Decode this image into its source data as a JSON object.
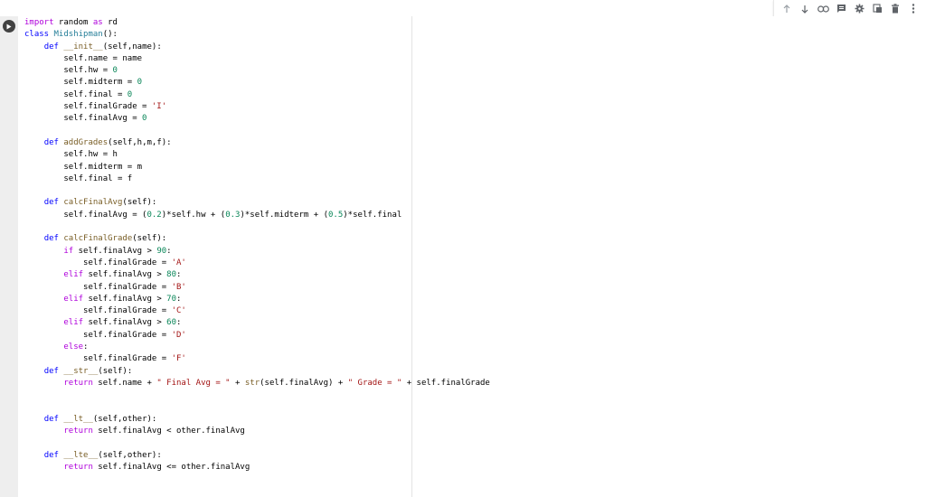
{
  "toolbar": {
    "icons": [
      "arrow-up-icon",
      "arrow-down-icon",
      "link-icon",
      "comment-icon",
      "gear-icon",
      "mirror-cell-icon",
      "trash-icon",
      "more-vert-icon"
    ]
  },
  "colors": {
    "keyword": "#af00db",
    "def": "#0000ff",
    "function": "#795e26",
    "class": "#267f99",
    "number": "#098658",
    "string": "#a31515",
    "gutter": "#eeeeee"
  },
  "code": {
    "lines": [
      [
        {
          "t": "import",
          "c": "kw"
        },
        {
          "t": " random "
        },
        {
          "t": "as",
          "c": "kw"
        },
        {
          "t": " rd"
        }
      ],
      [
        {
          "t": "class",
          "c": "kd"
        },
        {
          "t": " "
        },
        {
          "t": "Midshipman",
          "c": "cls"
        },
        {
          "t": "():"
        }
      ],
      [
        {
          "t": "    "
        },
        {
          "t": "def",
          "c": "kd"
        },
        {
          "t": " "
        },
        {
          "t": "__init__",
          "c": "fn"
        },
        {
          "t": "(self,name):"
        }
      ],
      [
        {
          "t": "        self.name = name"
        }
      ],
      [
        {
          "t": "        self.hw = "
        },
        {
          "t": "0",
          "c": "num"
        }
      ],
      [
        {
          "t": "        self.midterm = "
        },
        {
          "t": "0",
          "c": "num"
        }
      ],
      [
        {
          "t": "        self.final = "
        },
        {
          "t": "0",
          "c": "num"
        }
      ],
      [
        {
          "t": "        self.finalGrade = "
        },
        {
          "t": "'I'",
          "c": "str"
        }
      ],
      [
        {
          "t": "        self.finalAvg = "
        },
        {
          "t": "0",
          "c": "num"
        }
      ],
      [
        {
          "t": ""
        }
      ],
      [
        {
          "t": "    "
        },
        {
          "t": "def",
          "c": "kd"
        },
        {
          "t": " "
        },
        {
          "t": "addGrades",
          "c": "fn"
        },
        {
          "t": "(self,h,m,f):"
        }
      ],
      [
        {
          "t": "        self.hw = h"
        }
      ],
      [
        {
          "t": "        self.midterm = m"
        }
      ],
      [
        {
          "t": "        self.final = f"
        }
      ],
      [
        {
          "t": ""
        }
      ],
      [
        {
          "t": "    "
        },
        {
          "t": "def",
          "c": "kd"
        },
        {
          "t": " "
        },
        {
          "t": "calcFinalAvg",
          "c": "fn"
        },
        {
          "t": "(self):"
        }
      ],
      [
        {
          "t": "        self.finalAvg = ("
        },
        {
          "t": "0.2",
          "c": "num"
        },
        {
          "t": ")*self.hw + ("
        },
        {
          "t": "0.3",
          "c": "num"
        },
        {
          "t": ")*self.midterm + ("
        },
        {
          "t": "0.5",
          "c": "num"
        },
        {
          "t": ")*self.final"
        }
      ],
      [
        {
          "t": ""
        }
      ],
      [
        {
          "t": "    "
        },
        {
          "t": "def",
          "c": "kd"
        },
        {
          "t": " "
        },
        {
          "t": "calcFinalGrade",
          "c": "fn"
        },
        {
          "t": "(self):"
        }
      ],
      [
        {
          "t": "        "
        },
        {
          "t": "if",
          "c": "kw"
        },
        {
          "t": " self.finalAvg > "
        },
        {
          "t": "90",
          "c": "num"
        },
        {
          "t": ":"
        }
      ],
      [
        {
          "t": "            self.finalGrade = "
        },
        {
          "t": "'A'",
          "c": "str"
        }
      ],
      [
        {
          "t": "        "
        },
        {
          "t": "elif",
          "c": "kw"
        },
        {
          "t": " self.finalAvg > "
        },
        {
          "t": "80",
          "c": "num"
        },
        {
          "t": ":"
        }
      ],
      [
        {
          "t": "            self.finalGrade = "
        },
        {
          "t": "'B'",
          "c": "str"
        }
      ],
      [
        {
          "t": "        "
        },
        {
          "t": "elif",
          "c": "kw"
        },
        {
          "t": " self.finalAvg > "
        },
        {
          "t": "70",
          "c": "num"
        },
        {
          "t": ":"
        }
      ],
      [
        {
          "t": "            self.finalGrade = "
        },
        {
          "t": "'C'",
          "c": "str"
        }
      ],
      [
        {
          "t": "        "
        },
        {
          "t": "elif",
          "c": "kw"
        },
        {
          "t": " self.finalAvg > "
        },
        {
          "t": "60",
          "c": "num"
        },
        {
          "t": ":"
        }
      ],
      [
        {
          "t": "            self.finalGrade = "
        },
        {
          "t": "'D'",
          "c": "str"
        }
      ],
      [
        {
          "t": "        "
        },
        {
          "t": "else",
          "c": "kw"
        },
        {
          "t": ":"
        }
      ],
      [
        {
          "t": "            self.finalGrade = "
        },
        {
          "t": "'F'",
          "c": "str"
        }
      ],
      [
        {
          "t": "    "
        },
        {
          "t": "def",
          "c": "kd"
        },
        {
          "t": " "
        },
        {
          "t": "__str__",
          "c": "fn"
        },
        {
          "t": "(self):"
        }
      ],
      [
        {
          "t": "        "
        },
        {
          "t": "return",
          "c": "kw"
        },
        {
          "t": " self.name + "
        },
        {
          "t": "\" Final Avg = \"",
          "c": "str"
        },
        {
          "t": " + "
        },
        {
          "t": "str",
          "c": "fn"
        },
        {
          "t": "(self.finalAvg) + "
        },
        {
          "t": "\" Grade = \"",
          "c": "str"
        },
        {
          "t": " + self.finalGrade"
        }
      ],
      [
        {
          "t": ""
        }
      ],
      [
        {
          "t": ""
        }
      ],
      [
        {
          "t": "    "
        },
        {
          "t": "def",
          "c": "kd"
        },
        {
          "t": " "
        },
        {
          "t": "__lt__",
          "c": "fn"
        },
        {
          "t": "(self,other):"
        }
      ],
      [
        {
          "t": "        "
        },
        {
          "t": "return",
          "c": "kw"
        },
        {
          "t": " self.finalAvg < other.finalAvg"
        }
      ],
      [
        {
          "t": ""
        }
      ],
      [
        {
          "t": "    "
        },
        {
          "t": "def",
          "c": "kd"
        },
        {
          "t": " "
        },
        {
          "t": "__lte__",
          "c": "fn"
        },
        {
          "t": "(self,other):"
        }
      ],
      [
        {
          "t": "        "
        },
        {
          "t": "return",
          "c": "kw"
        },
        {
          "t": " self.finalAvg <= other.finalAvg"
        }
      ]
    ]
  }
}
